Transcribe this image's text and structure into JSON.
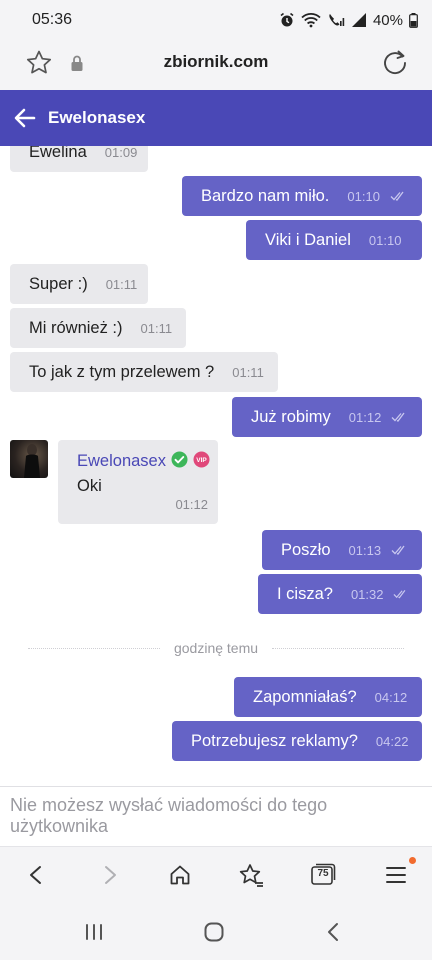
{
  "status_bar": {
    "time": "05:36",
    "battery": "40%",
    "icons": [
      "alarm-icon",
      "wifi-icon",
      "call-signal-icon",
      "signal-icon",
      "battery-icon"
    ]
  },
  "browser": {
    "url": "zbiornik.com",
    "tab_count": "75"
  },
  "chat": {
    "title": "Ewelonasex",
    "messages": [
      {
        "dir": "in",
        "text": "Ewelina",
        "time": "01:09"
      },
      {
        "dir": "out",
        "text": "Bardzo nam miło.",
        "time": "01:10"
      },
      {
        "dir": "out",
        "text": "Viki i Daniel",
        "time": "01:10"
      },
      {
        "dir": "in",
        "text": "Super :)",
        "time": "01:11"
      },
      {
        "dir": "in",
        "text": "Mi również :)",
        "time": "01:11"
      },
      {
        "dir": "in",
        "text": "To jak z tym przelewem ?",
        "time": "01:11"
      },
      {
        "dir": "out",
        "text": "Już robimy",
        "time": "01:12"
      },
      {
        "dir": "in-card",
        "sender": "Ewelonasex",
        "badge": "VIP",
        "text": "Oki",
        "time": "01:12"
      },
      {
        "dir": "out",
        "text": "Poszło",
        "time": "01:13"
      },
      {
        "dir": "out",
        "text": "I cisza?",
        "time": "01:32"
      },
      {
        "dir": "out",
        "text": "Zapomniałaś?",
        "time": "04:12"
      },
      {
        "dir": "out",
        "text": "Potrzebujesz reklamy?",
        "time": "04:22"
      }
    ],
    "divider": "godzinę temu",
    "notice": "Nie możesz wysłać wiadomości do tego użytkownika"
  },
  "colors": {
    "header": "#4a48b6",
    "outgoing_bubble": "#6563c6",
    "incoming_bubble": "#e9e9ec",
    "verified": "#3db65a",
    "vip": "#e0487a",
    "notification_dot": "#f26b2e"
  }
}
